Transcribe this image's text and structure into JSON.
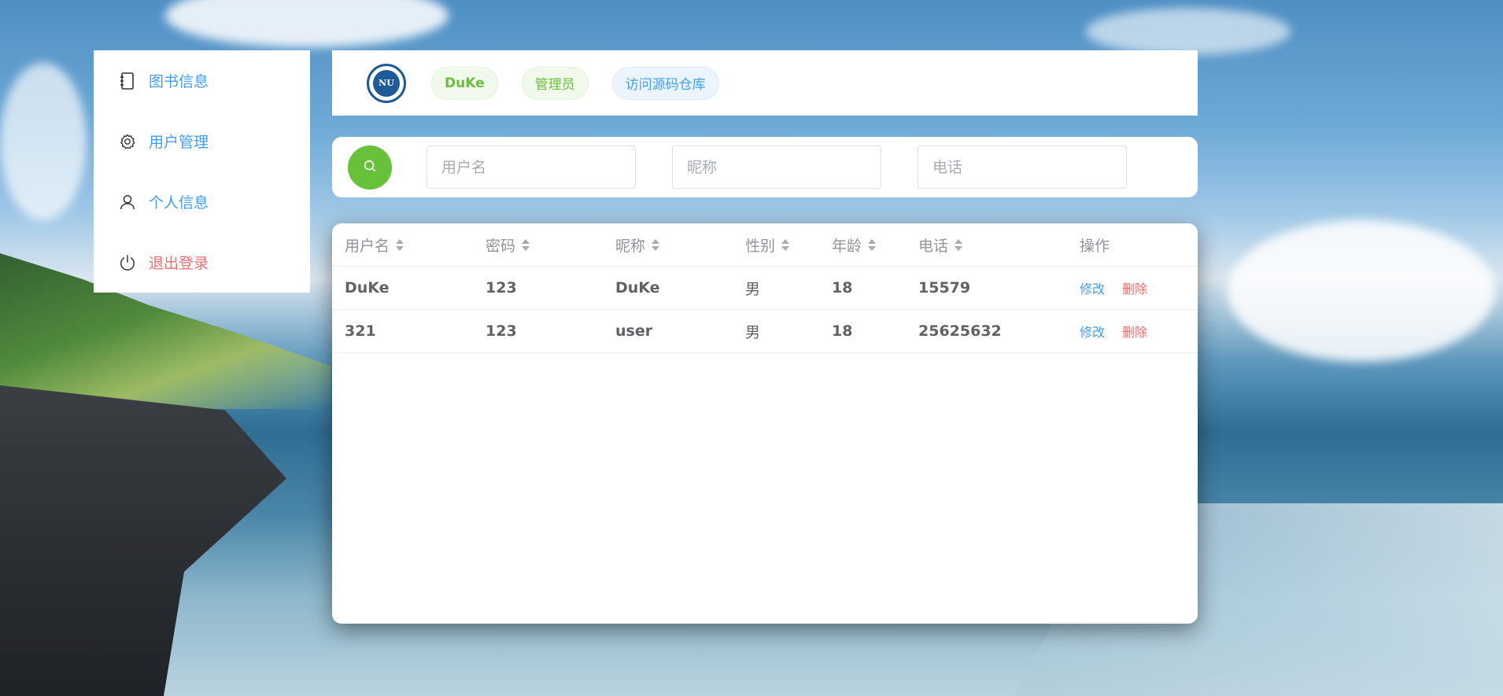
{
  "colors": {
    "primary": "#409eff",
    "success": "#67c23a",
    "danger": "#f56c6c"
  },
  "sidebar": {
    "items": [
      {
        "label": "图书信息",
        "icon": "notebook-icon"
      },
      {
        "label": "用户管理",
        "icon": "gear-icon"
      },
      {
        "label": "个人信息",
        "icon": "user-icon"
      },
      {
        "label": "退出登录",
        "icon": "power-icon"
      }
    ]
  },
  "header": {
    "logo_text": "NU",
    "username_tag": "DuKe",
    "role_tag": "管理员",
    "repo_link": "访问源码仓库"
  },
  "search": {
    "username_placeholder": "用户名",
    "nickname_placeholder": "昵称",
    "phone_placeholder": "电话"
  },
  "table": {
    "columns": [
      "用户名",
      "密码",
      "昵称",
      "性别",
      "年龄",
      "电话",
      "操作"
    ],
    "rows": [
      {
        "username": "DuKe",
        "password": "123",
        "nickname": "DuKe",
        "gender": "男",
        "age": "18",
        "phone": "15579"
      },
      {
        "username": "321",
        "password": "123",
        "nickname": "user",
        "gender": "男",
        "age": "18",
        "phone": "25625632"
      }
    ],
    "edit_label": "修改",
    "delete_label": "删除"
  }
}
